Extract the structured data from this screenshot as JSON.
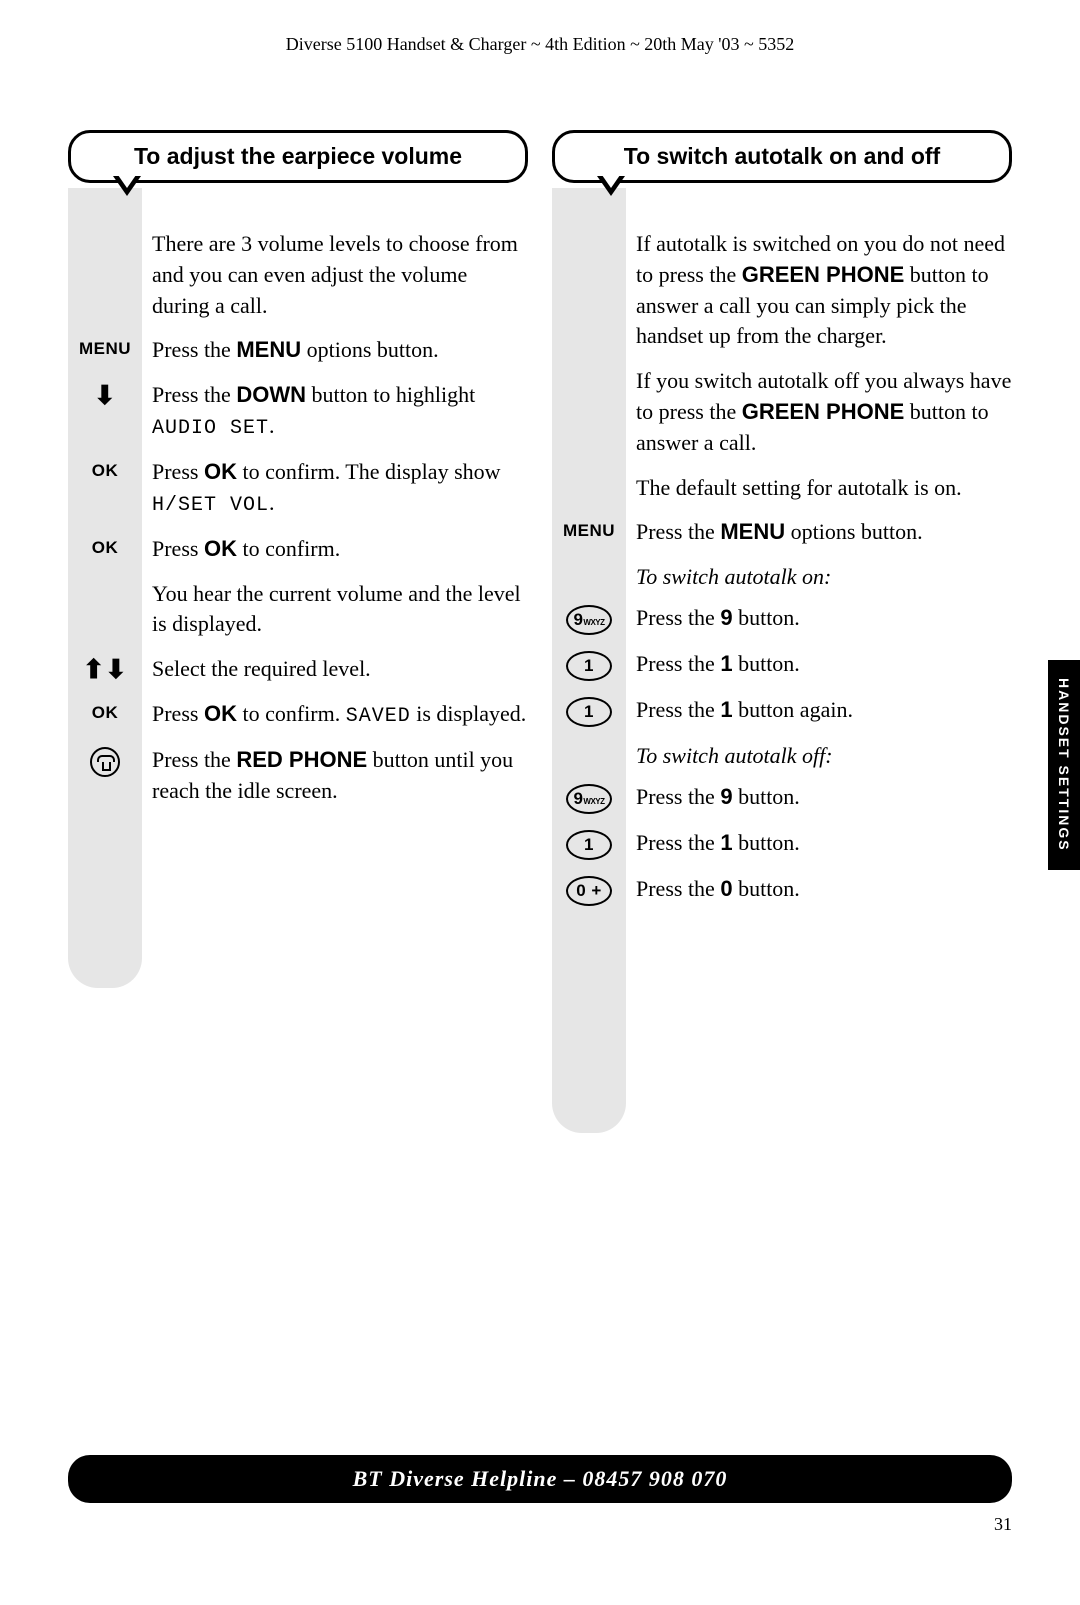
{
  "header": "Diverse 5100 Handset & Charger ~ 4th Edition ~ 20th May '03 ~ 5352",
  "side_tab": "HANDSET SETTINGS",
  "footer": "BT Diverse Helpline – 08457 908 070",
  "page_number": "31",
  "left": {
    "title": "To adjust the earpiece volume",
    "intro": "There are 3 volume levels to choose from and you can even adjust the volume during a call.",
    "steps": {
      "s1_icon": "MENU",
      "s1_pre": "Press the ",
      "s1_bold": "MENU",
      "s1_post": " options button.",
      "s2_pre": "Press the ",
      "s2_bold": "DOWN",
      "s2_post": " button to highlight ",
      "s2_mono": "AUDIO SET",
      "s2_tail": ".",
      "s3_icon": "OK",
      "s3_pre": "Press ",
      "s3_bold": "OK",
      "s3_post": " to confirm. The display show ",
      "s3_mono": "H/SET VOL",
      "s3_tail": ".",
      "s4_icon": "OK",
      "s4_pre": "Press ",
      "s4_bold": "OK",
      "s4_post": " to confirm.",
      "s4b": "You hear the current volume and the level is displayed.",
      "s5": "Select the required level.",
      "s6_icon": "OK",
      "s6_pre": "Press ",
      "s6_bold": "OK",
      "s6_post": " to confirm. ",
      "s6_mono": "SAVED",
      "s6_tail": " is displayed.",
      "s7_pre": "Press the ",
      "s7_bold": "RED PHONE",
      "s7_post": " button until you reach the idle screen."
    }
  },
  "right": {
    "title": "To switch autotalk on and off",
    "intro1_pre": "If autotalk is switched on you do not need to press the ",
    "intro1_bold": "GREEN PHONE",
    "intro1_post": " button to answer a call you can simply pick the handset up from the charger.",
    "intro2_pre": "If you switch autotalk off you always have to press the ",
    "intro2_bold": "GREEN PHONE",
    "intro2_post": " button to answer a call.",
    "intro3": "The default setting for autotalk is on.",
    "menu_icon": "MENU",
    "menu_pre": "Press the ",
    "menu_bold": "MENU",
    "menu_post": " options button.",
    "sub_on": "To switch autotalk on:",
    "on1_pre": "Press the ",
    "on1_bold": "9",
    "on1_post": " button.",
    "on2_pre": "Press the ",
    "on2_bold": "1",
    "on2_post": " button.",
    "on3_pre": "Press the ",
    "on3_bold": "1",
    "on3_post": " button again.",
    "sub_off": "To switch autotalk off:",
    "off1_pre": "Press the ",
    "off1_bold": "9",
    "off1_post": " button.",
    "off2_pre": "Press the ",
    "off2_bold": "1",
    "off2_post": " button.",
    "off3_pre": "Press the ",
    "off3_bold": "0",
    "off3_post": " button.",
    "key9": "9",
    "key9sub": "WXYZ",
    "key1": "1",
    "key0": "0 +"
  }
}
